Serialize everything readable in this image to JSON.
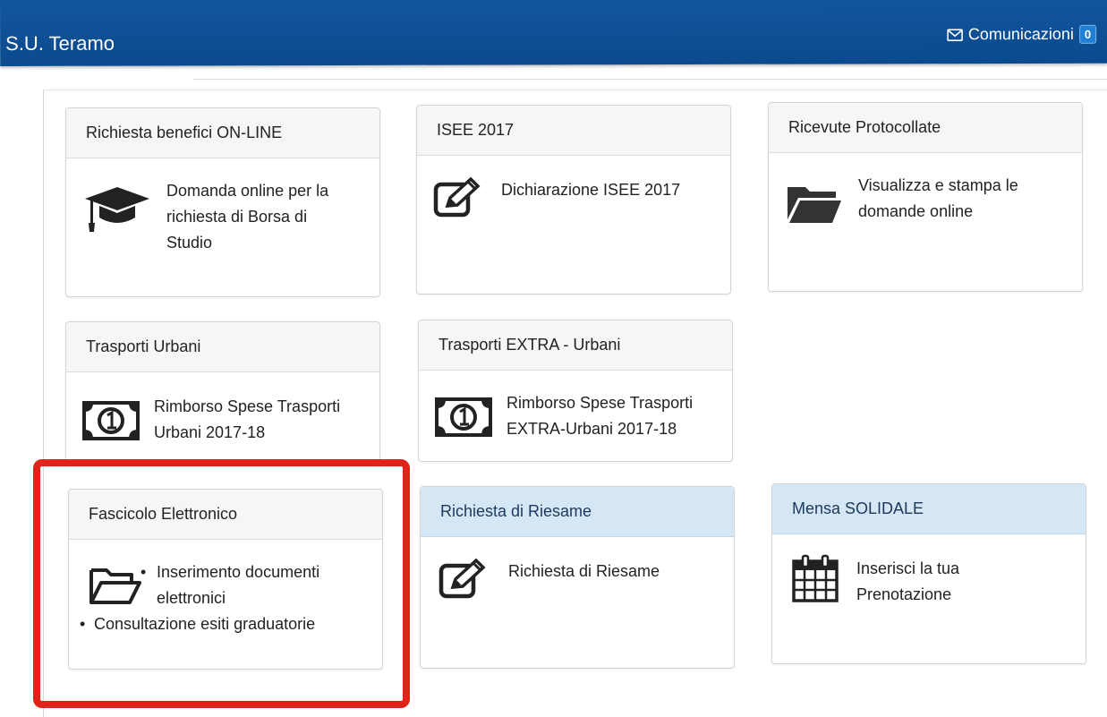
{
  "header": {
    "brand": "S.U. Teramo",
    "comunicazioni_label": "Comunicazioni",
    "comunicazioni_count": "0"
  },
  "panels": {
    "benefici": {
      "title": "Richiesta benefici ON-LINE",
      "icon": "graduation-cap-icon",
      "lines": [
        "Domanda online per la",
        "richiesta di Borsa di",
        "Studio"
      ]
    },
    "isee": {
      "title": "ISEE 2017",
      "icon": "edit-icon",
      "text": "Dichiarazione ISEE 2017"
    },
    "ricevute": {
      "title": "Ricevute Protocollate",
      "icon": "folder-icon",
      "lines": [
        "Visualizza e stampa le",
        "domande online"
      ]
    },
    "trasporti_urbani": {
      "title": "Trasporti Urbani",
      "icon": "money-icon",
      "lines": [
        "Rimborso Spese Trasporti",
        "Urbani 2017-18"
      ]
    },
    "trasporti_extra": {
      "title": "Trasporti EXTRA - Urbani",
      "icon": "money-icon",
      "lines": [
        "Rimborso Spese Trasporti",
        "EXTRA-Urbani 2017-18"
      ]
    },
    "fascicolo": {
      "title": "Fascicolo Elettronico",
      "icon": "folder-open-icon",
      "item1_lines": [
        "Inserimento documenti",
        "elettronici"
      ],
      "item2": "Consultazione esiti graduatorie"
    },
    "riesame": {
      "title": "Richiesta di Riesame",
      "icon": "edit-icon",
      "text": "Richiesta di Riesame"
    },
    "mensa": {
      "title": "Mensa SOLIDALE",
      "icon": "calendar-icon",
      "lines": [
        "Inserisci la tua",
        "Prenotazione"
      ]
    }
  },
  "colors": {
    "navbar": "#0d4f96",
    "info_heading": "#d5e6f5",
    "highlight": "#e2231a"
  }
}
